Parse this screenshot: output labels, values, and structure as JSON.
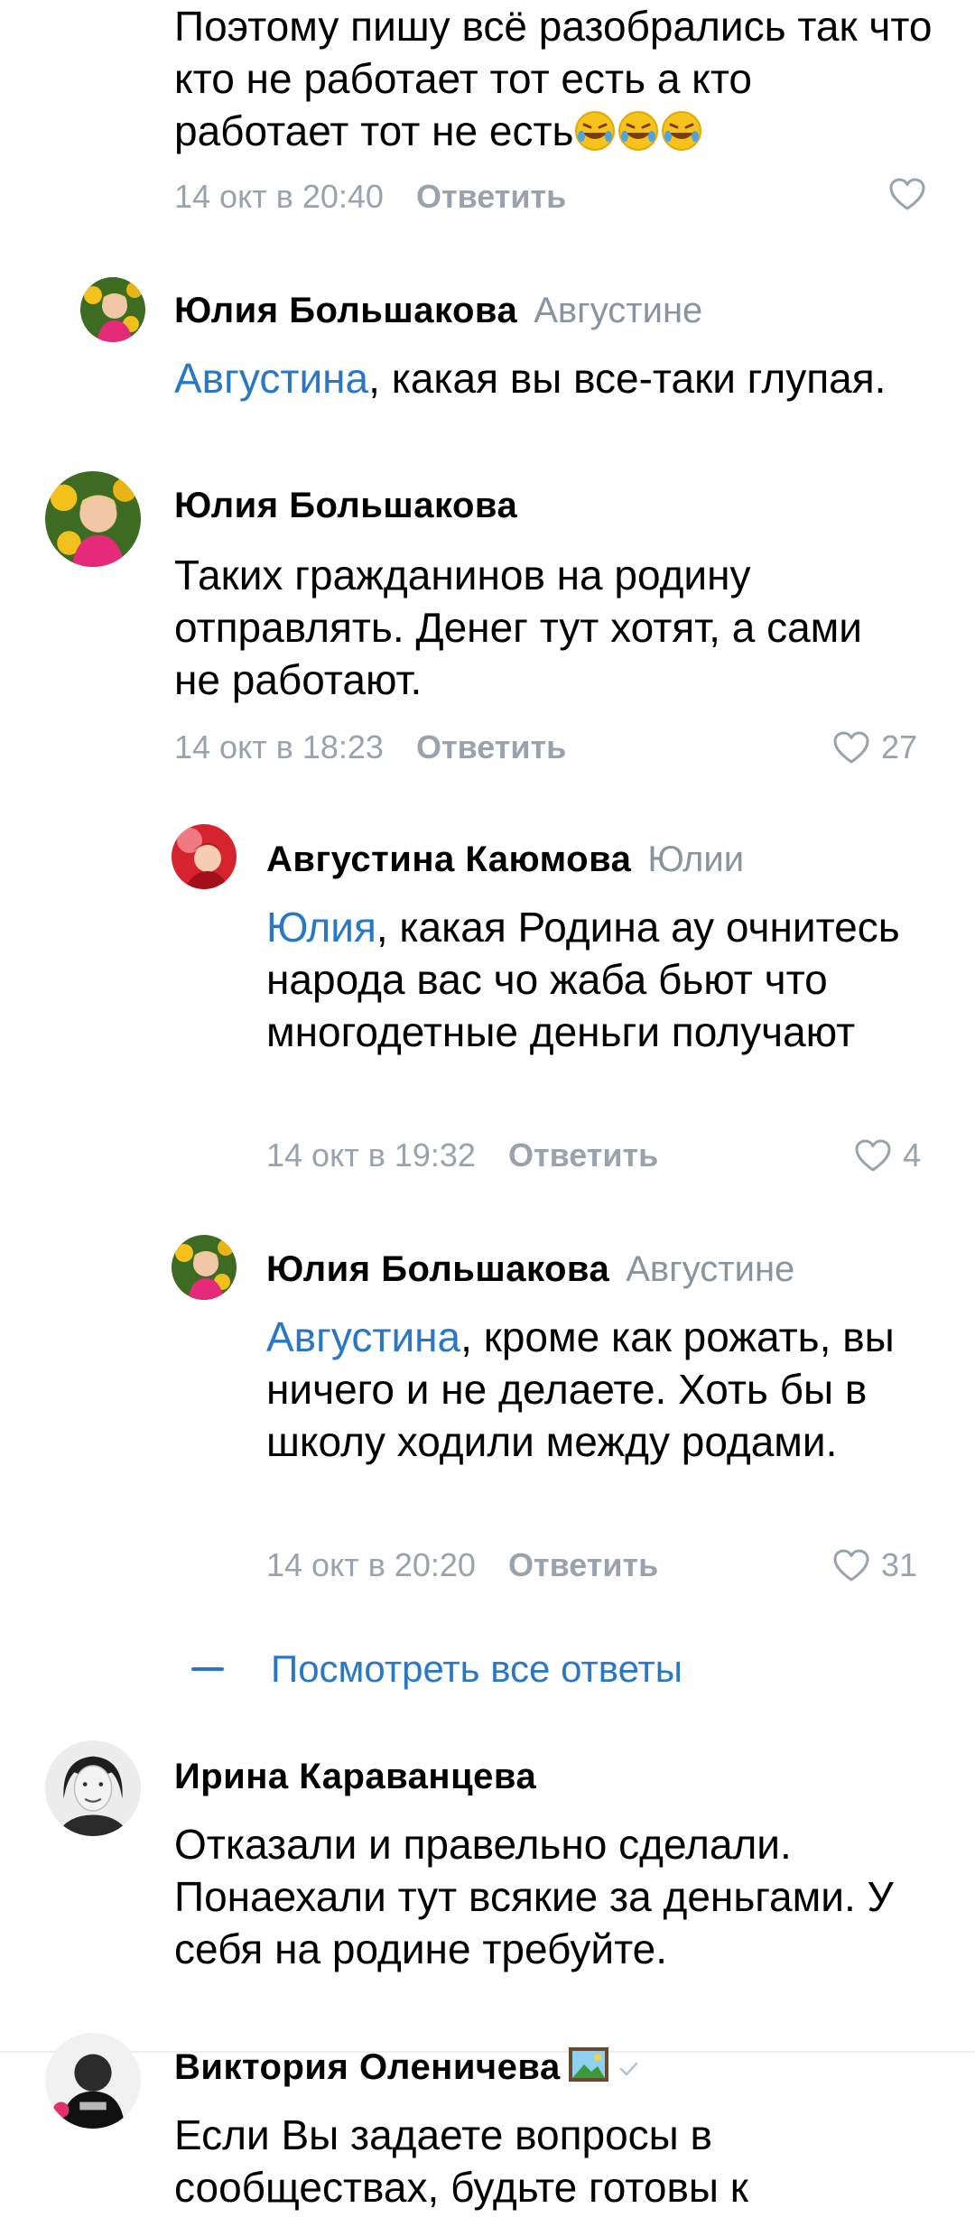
{
  "comments": [
    {
      "text": "Поэтому пишу всё разобрались так что кто не работает тот есть а кто работает тот не есть",
      "emojis": [
        "rolling-on-floor-laughing-emoji",
        "rolling-on-floor-laughing-emoji",
        "rolling-on-floor-laughing-emoji"
      ],
      "time": "14 окт в 20:40",
      "reply_label": "Ответить",
      "likes": ""
    },
    {
      "author": "Юлия Большакова",
      "reply_to": "Августине",
      "mention": "Августина",
      "text": ", какая вы все-таки глупая."
    },
    {
      "author": "Юлия Большакова",
      "text": "Таких гражданинов на родину отправлять. Денег тут хотят, а сами не работают.",
      "time": "14 окт в 18:23",
      "reply_label": "Ответить",
      "likes": "27"
    },
    {
      "author": "Августина Каюмова",
      "reply_to": "Юлии",
      "mention": "Юлия",
      "text": ", какая Родина ау очнитесь народа вас чо жаба бьют что многодетные деньги получают",
      "time": "14 окт в 19:32",
      "reply_label": "Ответить",
      "likes": "4"
    },
    {
      "author": "Юлия Большакова",
      "reply_to": "Августине",
      "mention": "Августина",
      "text": ", кроме как рожать, вы ничего и не делаете. Хоть бы в школу ходили между родами.",
      "time": "14 окт в 20:20",
      "reply_label": "Ответить",
      "likes": "31"
    },
    {
      "author": "Ирина Караванцева",
      "text": "Отказали и правельно сделали. Понаехали тут   всякие за деньгами. У себя на родине требуйте."
    },
    {
      "author": "Виктория Оленичева",
      "text": "Если Вы задаете вопросы в сообществах, будьте готовы к"
    }
  ],
  "show_all_replies": "Посмотреть все ответы",
  "colors": {
    "link": "#2a78c5",
    "secondary": "#9aa3ad"
  },
  "icons": {
    "like": "heart-outline-icon",
    "verified": "checkmark-icon",
    "name_emoji": "framed-picture-emoji"
  }
}
